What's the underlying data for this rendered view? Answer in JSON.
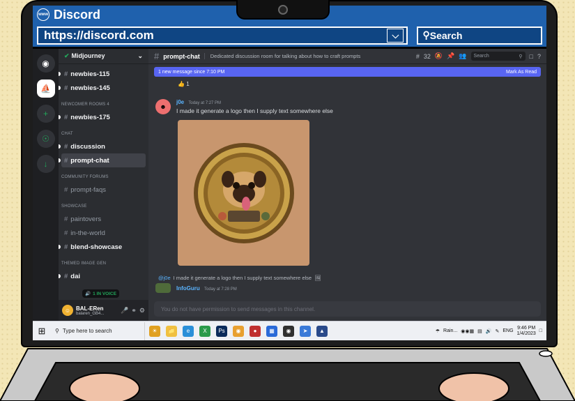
{
  "browser": {
    "title": "Discord",
    "logo_text": "www",
    "url": "https://discord.com",
    "search_placeholder": "Search"
  },
  "server": {
    "name": "Midjourney"
  },
  "channels": [
    {
      "type": "channel",
      "label": "newbies-115",
      "bold": true
    },
    {
      "type": "channel",
      "label": "newbies-145",
      "bold": true
    },
    {
      "type": "category",
      "label": "NEWCOMER ROOMS 4"
    },
    {
      "type": "channel",
      "label": "newbies-175",
      "bold": true
    },
    {
      "type": "category",
      "label": "CHAT"
    },
    {
      "type": "channel",
      "label": "discussion",
      "bold": true
    },
    {
      "type": "channel",
      "label": "prompt-chat",
      "bold": true,
      "selected": true
    },
    {
      "type": "category",
      "label": "COMMUNITY FORUMS"
    },
    {
      "type": "channel",
      "label": "prompt-faqs"
    },
    {
      "type": "category",
      "label": "SHOWCASE"
    },
    {
      "type": "channel",
      "label": "paintovers"
    },
    {
      "type": "channel",
      "label": "in-the-world"
    },
    {
      "type": "channel",
      "label": "blend-showcase",
      "bold": true
    },
    {
      "type": "category",
      "label": "THEMED IMAGE GEN"
    },
    {
      "type": "channel",
      "label": "dai",
      "bold": true
    }
  ],
  "voice_badge": "1 IN VOICE",
  "user": {
    "name": "BAL-ERen",
    "tag": "balaren_GB4..."
  },
  "channel_header": {
    "name": "prompt-chat",
    "topic": "Dedicated discussion room for talking about how to craft prompts",
    "threads_count": "32",
    "search_placeholder": "Search"
  },
  "new_message_bar": {
    "text": "1 new message since 7:10 PM",
    "action": "Mark As Read"
  },
  "reaction_count": "1",
  "message": {
    "author": "j0e",
    "timestamp": "Today at 7:27 PM",
    "text": "I made it generate a logo then I supply text somewhere else"
  },
  "reply": {
    "mention": "@j0e",
    "text": "I made it generate a logo then I supply text somewhere else",
    "author": "InfoGuru",
    "timestamp": "Today at 7:28 PM"
  },
  "input_placeholder": "You do not have permission to send messages in this channel.",
  "taskbar": {
    "search_placeholder": "Type here to search",
    "weather": "Rain...",
    "lang": "ENG",
    "time": "9:46 PM",
    "date": "1/4/2023"
  },
  "colors": {
    "accent": "#5865f2",
    "browser_bar": "#1f61ad",
    "discord_bg": "#313338"
  }
}
